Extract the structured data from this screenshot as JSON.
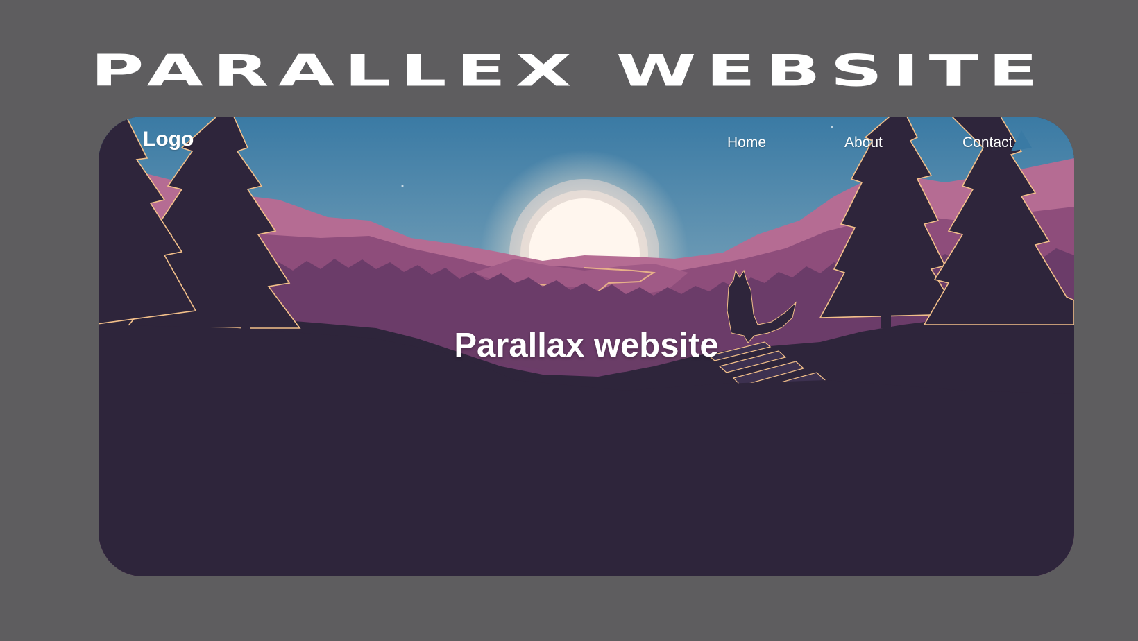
{
  "page": {
    "heading": "PARALLEX WEBSITE"
  },
  "site": {
    "logo": "Logo",
    "nav": [
      {
        "label": "Home"
      },
      {
        "label": "About"
      },
      {
        "label": "Contact"
      }
    ],
    "hero_title": "Parallax website"
  },
  "colors": {
    "page_background": "#5e5d5f",
    "sky_top": "#3a7aa4",
    "sky_horizon": "#b7839e",
    "mountain_far": "#b56c93",
    "mountain_mid": "#8e4d7b",
    "forest": "#6b3c69",
    "foreground": "#2e253b",
    "sun": "#fff3e6",
    "highlight": "#f3c08a"
  },
  "icons": {
    "scene": "sunset-mountain-forest-fox-illustration"
  }
}
